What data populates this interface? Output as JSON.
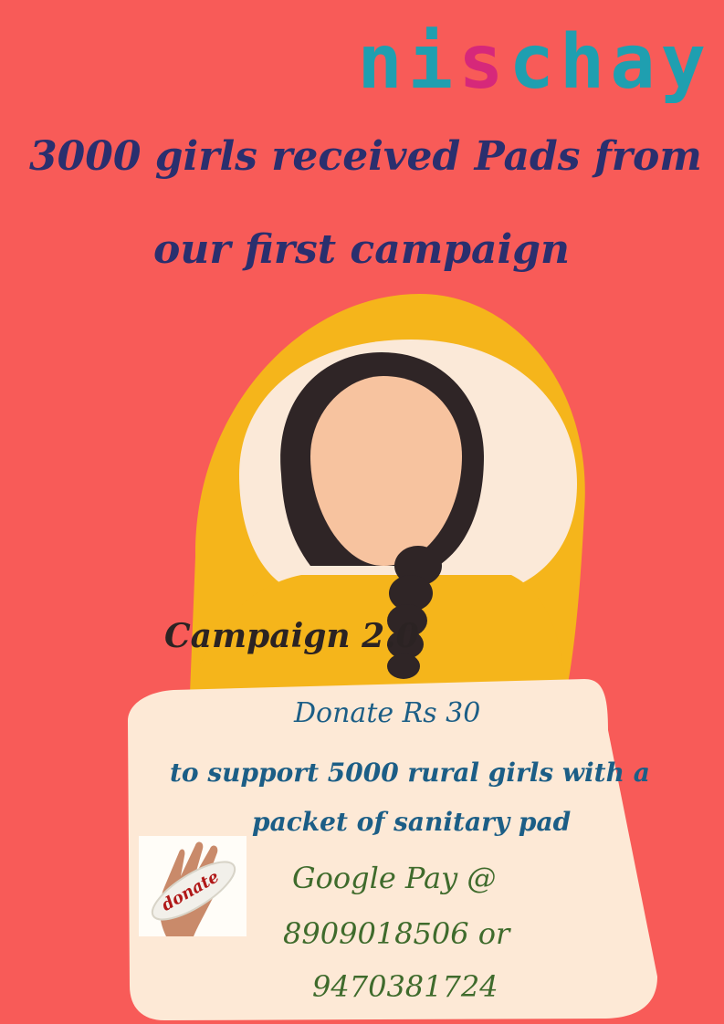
{
  "logo": {
    "pre": "ni",
    "accent": "s",
    "post": "chay"
  },
  "headline": {
    "line1": "3000 girls received Pads from",
    "line2": "our first campaign"
  },
  "campaign_label": "Campaign 2.0",
  "sign": {
    "donate": "Donate Rs 30",
    "support": "to support 5000 rural girls with a",
    "packet": "packet of sanitary pad",
    "gpay": "Google Pay @",
    "phone1": "8909018506 or",
    "phone2": "9470381724"
  },
  "donate_image": {
    "label": "donate"
  },
  "colors": {
    "background": "#f85b58",
    "hood": "#f5b51b",
    "hair": "#2f2526",
    "skin": "#f7c39f",
    "sign": "#fde9d6",
    "logo": "#1f9fb0",
    "logo_accent": "#d6287a",
    "headline": "#2a2f6e",
    "sign_blue": "#1c5e86",
    "sign_green": "#3f6b2c"
  }
}
